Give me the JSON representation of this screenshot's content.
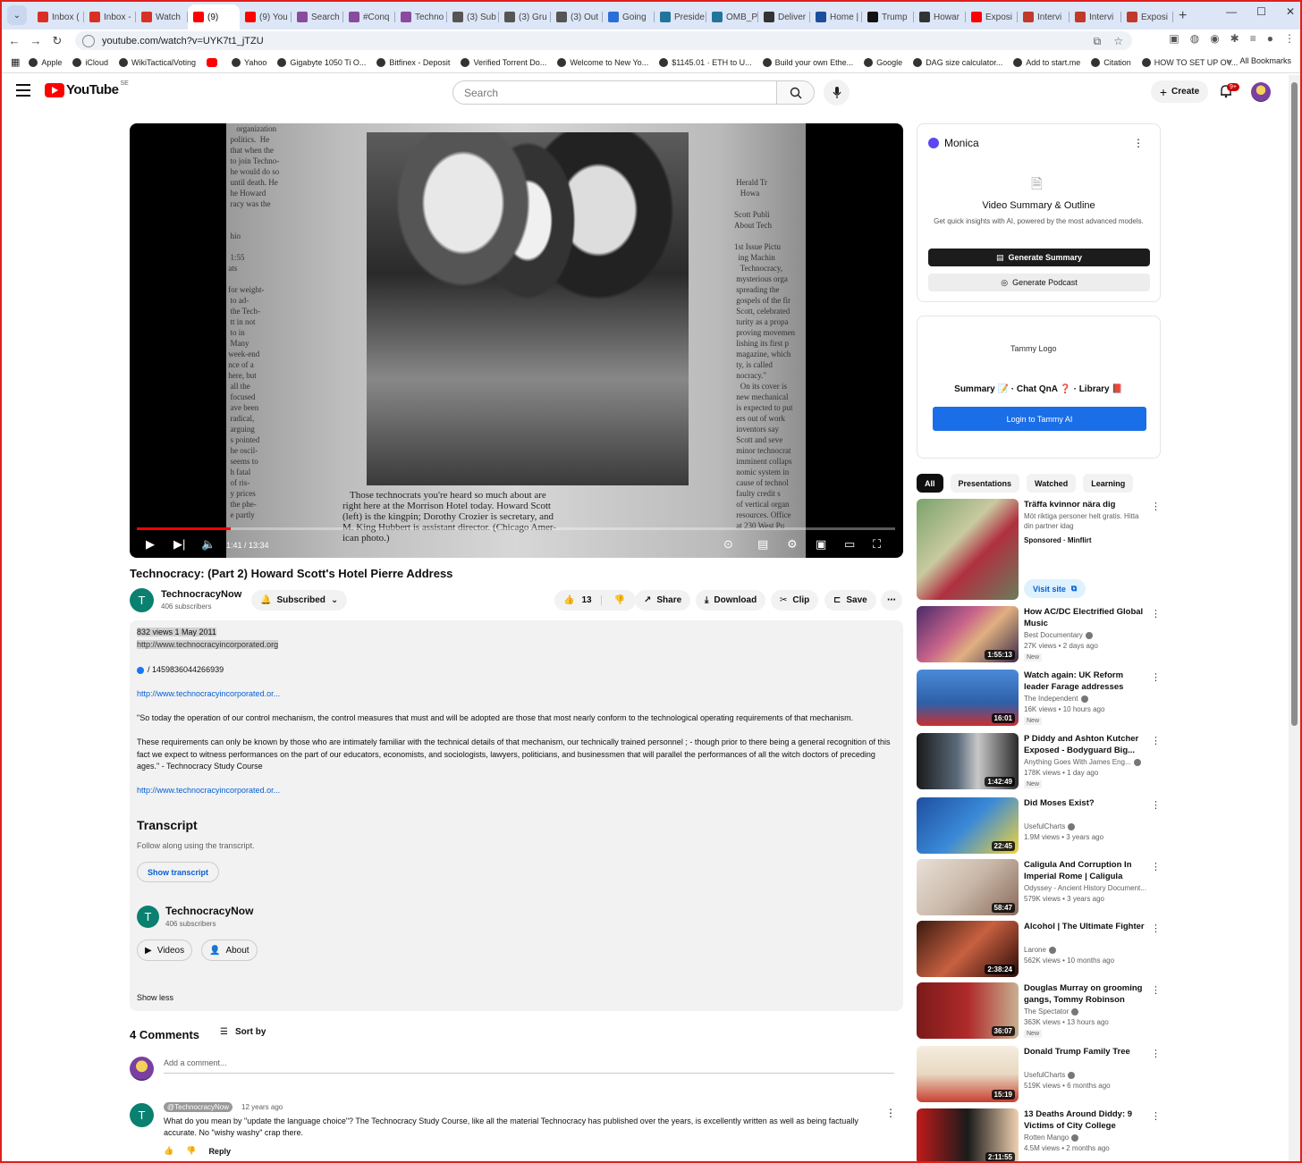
{
  "browser": {
    "tabs": [
      {
        "label": "Inbox (",
        "color": "#d93025"
      },
      {
        "label": "Inbox -",
        "color": "#d93025"
      },
      {
        "label": "Watch",
        "color": "#d93025"
      },
      {
        "label": "(9)",
        "color": "#ff0000"
      },
      {
        "label": "(9) You",
        "color": "#ff0000"
      },
      {
        "label": "Search",
        "color": "#8a4b9e"
      },
      {
        "label": "#Conq",
        "color": "#8a4b9e"
      },
      {
        "label": "Techno",
        "color": "#8a4b9e"
      },
      {
        "label": "(3) Sub",
        "color": "#555555"
      },
      {
        "label": "(3) Gru",
        "color": "#555555"
      },
      {
        "label": "(3) Out",
        "color": "#555555"
      },
      {
        "label": "Going",
        "color": "#2b6fd6"
      },
      {
        "label": "Preside",
        "color": "#21759b"
      },
      {
        "label": "OMB_P",
        "color": "#21759b"
      },
      {
        "label": "Deliver",
        "color": "#333333"
      },
      {
        "label": "Home |",
        "color": "#1b4f9c"
      },
      {
        "label": "Trump",
        "color": "#111111"
      },
      {
        "label": "Howar",
        "color": "#333333"
      },
      {
        "label": "Exposi",
        "color": "#ff0000"
      },
      {
        "label": "Intervi",
        "color": "#c0392b"
      },
      {
        "label": "Intervi",
        "color": "#c0392b"
      },
      {
        "label": "Exposi",
        "color": "#c0392b"
      }
    ],
    "url": "youtube.com/watch?v=UYK7t1_jTZU",
    "bookmarks": [
      "Apple",
      "iCloud",
      "WikiTacticalVoting",
      "",
      "Yahoo",
      "Gigabyte 1050 Ti O...",
      "Bitfinex - Deposit",
      "Verified Torrent Do...",
      "Welcome to New Yo...",
      "$1145.01 · ETH to U...",
      "Build your own Ethe...",
      "Google",
      "DAG size calculator...",
      "Add to start.me",
      "Citation",
      "HOW TO SET UP OV..."
    ],
    "all_bookmarks": "All Bookmarks"
  },
  "yt": {
    "logo": "YouTube",
    "country": "SE",
    "search_placeholder": "Search",
    "create": "Create",
    "notif_badge": "9+"
  },
  "player": {
    "time": "1:41 / 13:34",
    "progress_fraction": 0.124,
    "caption_lines": "   Those technocrats you're heard so much about are\nright here at the Morrison Hotel today. Howard Scott\n(left) is the kingpin; Dorothy Crozier is secretary, and\nM. King Hubbert is assistant director. (Chicago Amer-\nican photo.)",
    "left_col": "     organization\n  politics.  He\n  that when the\n  to join Techno-\n  he would do so\n  until death. He\n  he Howard\n  racy was the\n\n\n  hio\n\n  1:55\n ats\n\n for weight-\n  to ad-\n  the Tech-\n  tt in not\n  to in\n  Many\n week-end\n nce of a\n here, but\n  all the\n  focused\n  ave been\n  radical,\n  arguing\n  s pointed\n  he oscil-\n  seems to\n  h fatal\n  of ris-\n  y prices\n  the phe-\n  e partly",
    "right_col": "\n\n\n\n\n Herald Tr\n   Howa\n\nScott Publi\nAbout Tech\n\n1st Issue Pictu\n  ing Machin\n   Technocracy,\n mysterious orga\n spreading the\n gospels of the fir\n Scott, celebrated\n turity as a propa\n proving movemen\n lishing its first p\n magazine, which\n ty, is called\n nocracy.\"\n   On its cover is\n new mechanical\n is expected to put\n ers out of work\n inventors say\n Scott and seve\n minor technocrat\n imminent collaps\n nomic system in\n cause of technol\n faulty credit s\n of vertical organ\n resources. Office\n at 230 West Pu"
  },
  "video": {
    "title": "Technocracy: (Part 2) Howard Scott's Hotel Pierre Address",
    "channel": "TechnocracyNow",
    "channel_initial": "T",
    "subscribers": "406 subscribers",
    "subscribed_label": "Subscribed",
    "likes": "13",
    "share": "Share",
    "download": "Download",
    "clip": "Clip",
    "save": "Save"
  },
  "description": {
    "meta": "832 views  1 May 2011",
    "link1": "http://www.technocracyincorporated.org",
    "fb": "/ 1459836044266939",
    "link2": "http://www.technocracyincorporated.or...",
    "quote1": "\"So today the operation of our control mechanism, the control measures that must and will be adopted are those that most nearly conform to the technological operating requirements of that mechanism.",
    "quote2": "These requirements can only be known by those who are intimately familiar with the technical details of that mechanism, our technically trained personnel ; - though prior to there being a general recognition of this fact we expect to witness performances on the part of our educators, economists, and sociologists, lawyers, politicians, and businessmen that will parallel the performances of all the witch doctors of preceding ages.\" - Technocracy Study Course",
    "link3": "http://www.technocracyincorporated.or...",
    "transcript_title": "Transcript",
    "transcript_sub": "Follow along using the transcript.",
    "show_transcript": "Show transcript",
    "videos_btn": "Videos",
    "about_btn": "About",
    "show_less": "Show less"
  },
  "comments": {
    "count_label": "4 Comments",
    "sort_by": "Sort by",
    "add_placeholder": "Add a comment...",
    "first": {
      "handle": "@TechnocracyNow",
      "time": "12 years ago",
      "text": "What do you mean by \"update the language choice\"? The Technocracy Study Course, like all the material Technocracy has published over the years, is excellently written as well as being factually accurate. No \"wishy washy\" crap there.",
      "reply": "Reply"
    }
  },
  "monica": {
    "title": "Monica",
    "heading": "Video Summary & Outline",
    "desc": "Get quick insights with AI, powered by the most advanced models.",
    "gen_summary": "Generate Summary",
    "gen_podcast": "Generate Podcast"
  },
  "tammy": {
    "logo_alt": "Tammy Logo",
    "nav": "Summary 📝 · Chat QnA ❓ · Library 📕",
    "login": "Login to Tammy AI"
  },
  "chips": [
    "All",
    "Presentations",
    "Watched",
    "Learning"
  ],
  "recommendations": [
    {
      "title": "Träffa kvinnor nära dig",
      "channel": "Möt riktiga personer helt gratis. Hitta din partner idag",
      "meta": "Sponsored · Minflirt",
      "duration": "",
      "new": "",
      "visit": "Visit site",
      "bg": "linear-gradient(135deg,#7aa36a,#c9c9a0 40%,#b03040 60%,#6b7b5b)"
    },
    {
      "title": "How AC/DC Electrified Global Music",
      "channel": "Best Documentary",
      "meta": "27K views • 2 days ago",
      "duration": "1:55:13",
      "new": "New",
      "bg": "linear-gradient(135deg,#4a2a6a,#c8648a 40%,#e0b080 60%,#3a2a4a)"
    },
    {
      "title": "Watch again: UK Reform leader Farage addresses party...",
      "channel": "The Independent",
      "meta": "16K views • 10 hours ago",
      "duration": "16:01",
      "new": "New",
      "bg": "linear-gradient(180deg,#4a8ad8,#2f5fa8 60%,#c93030)"
    },
    {
      "title": "P Diddy and Ashton Kutcher Exposed - Bodyguard Big...",
      "channel": "Anything Goes With James Eng...",
      "meta": "178K views • 1 day ago",
      "duration": "1:42:49",
      "new": "New",
      "bg": "linear-gradient(90deg,#1a1a1a,#5a6a7a 40%,#c8c8c8 60%,#2a2a2a)"
    },
    {
      "title": "Did Moses Exist?",
      "channel": "UsefulCharts",
      "meta": "1.9M views • 3 years ago",
      "duration": "22:45",
      "new": "",
      "bg": "linear-gradient(135deg,#1f4fa0,#3a8ad8 50%,#f2d33a)"
    },
    {
      "title": "Caligula And Corruption In Imperial Rome | Caligula With...",
      "channel": "Odyssey - Ancient History Document...",
      "meta": "579K views • 3 years ago",
      "duration": "58:47",
      "new": "",
      "bg": "linear-gradient(135deg,#e8e0d8,#c9b8a8 50%,#8a6a5a)"
    },
    {
      "title": "Alcohol | The Ultimate Fighter",
      "channel": "Larone",
      "meta": "562K views • 10 months ago",
      "duration": "2:38:24",
      "new": "",
      "bg": "linear-gradient(135deg,#3a1a10,#c86040 50%,#2a0a08)"
    },
    {
      "title": "Douglas Murray on grooming gangs, Tommy Robinson and...",
      "channel": "The Spectator",
      "meta": "363K views • 13 hours ago",
      "duration": "36:07",
      "new": "New",
      "bg": "linear-gradient(90deg,#7a1a1a,#b02a2a 50%,#c8b090)"
    },
    {
      "title": "Donald Trump Family Tree",
      "channel": "UsefulCharts",
      "meta": "519K views • 6 months ago",
      "duration": "15:19",
      "new": "",
      "bg": "linear-gradient(180deg,#f5ede0,#e8d8c0 50%,#c84030)"
    },
    {
      "title": "13 Deaths Around Diddy: 9 Victims of City College Inciden...",
      "channel": "Rotten Mango",
      "meta": "4.5M views • 2 months ago",
      "duration": "2:11:55",
      "new": "",
      "bg": "linear-gradient(90deg,#c01a1a,#1a1a1a 50%,#f0d0b0)"
    }
  ],
  "colors": {
    "accent_red": "#ff0000",
    "link_blue": "#065fd4",
    "channel_teal": "#0a8070",
    "frame_red": "#e0201c"
  }
}
